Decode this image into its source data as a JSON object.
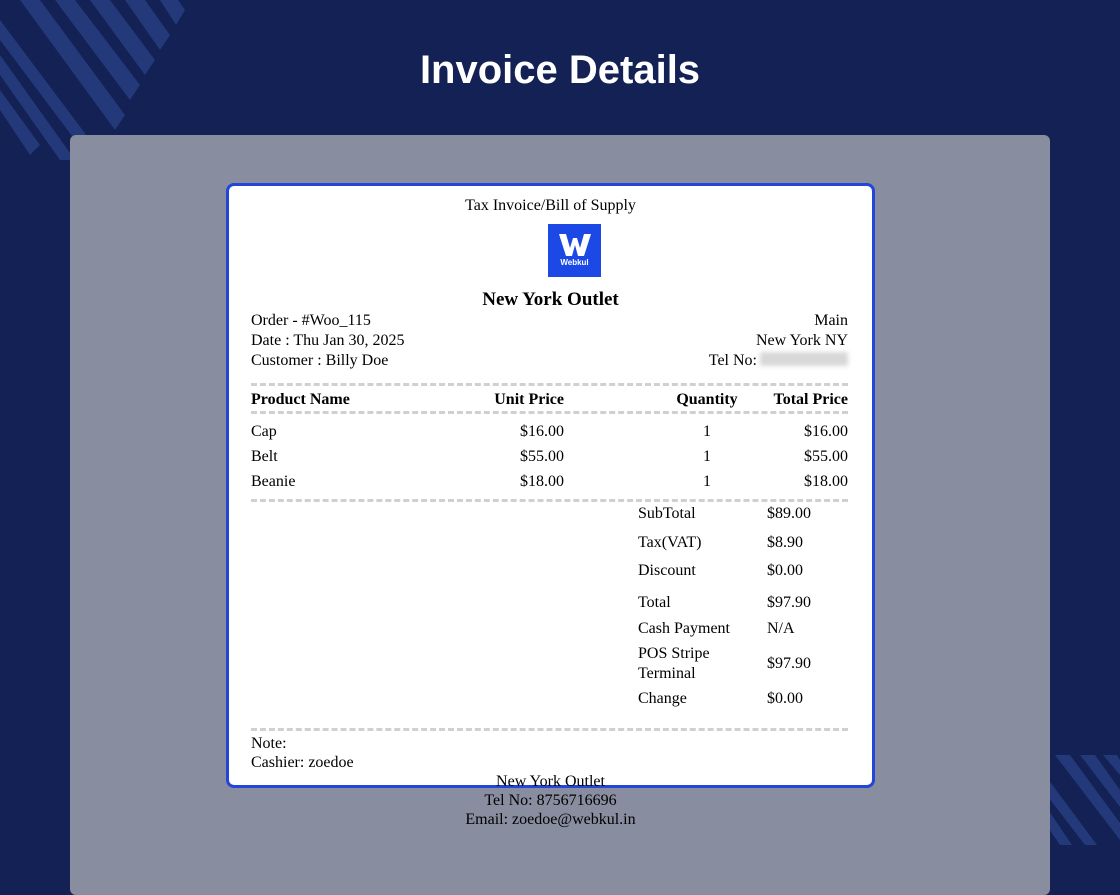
{
  "page": {
    "title": "Invoice Details"
  },
  "receipt": {
    "doc_type": "Tax Invoice/Bill of Supply",
    "logo_text": "Webkul",
    "store_name": "New York Outlet",
    "order": "Order - #Woo_115",
    "date": "Date : Thu Jan 30, 2025",
    "customer": "Customer : Billy Doe",
    "branch": "Main",
    "location": "New York NY",
    "tel_label": "Tel No:",
    "columns": {
      "name": "Product Name",
      "unit": "Unit Price",
      "qty": "Quantity",
      "total": "Total Price"
    },
    "items": [
      {
        "name": "Cap",
        "unit": "$16.00",
        "qty": "1",
        "total": "$16.00"
      },
      {
        "name": "Belt",
        "unit": "$55.00",
        "qty": "1",
        "total": "$55.00"
      },
      {
        "name": "Beanie",
        "unit": "$18.00",
        "qty": "1",
        "total": "$18.00"
      }
    ],
    "summary": {
      "subtotal_label": "SubTotal",
      "subtotal": "$89.00",
      "tax_label": "Tax(VAT)",
      "tax": "$8.90",
      "discount_label": "Discount",
      "discount": "$0.00",
      "total_label": "Total",
      "total": "$97.90",
      "cash_label": "Cash Payment",
      "cash": "N/A",
      "stripe_label_1": "POS Stripe",
      "stripe_label_2": "Terminal",
      "stripe": "$97.90",
      "change_label": "Change",
      "change": "$0.00"
    },
    "note": "Note:",
    "cashier": "Cashier: zoedoe",
    "footer_store": "New York Outlet",
    "footer_tel": "Tel No: 8756716696",
    "footer_email": "Email: zoedoe@webkul.in"
  },
  "colors": {
    "background": "#132154",
    "panel": "#888d9f",
    "receipt_border": "#2346d8",
    "logo_bg": "#1c49e6"
  }
}
